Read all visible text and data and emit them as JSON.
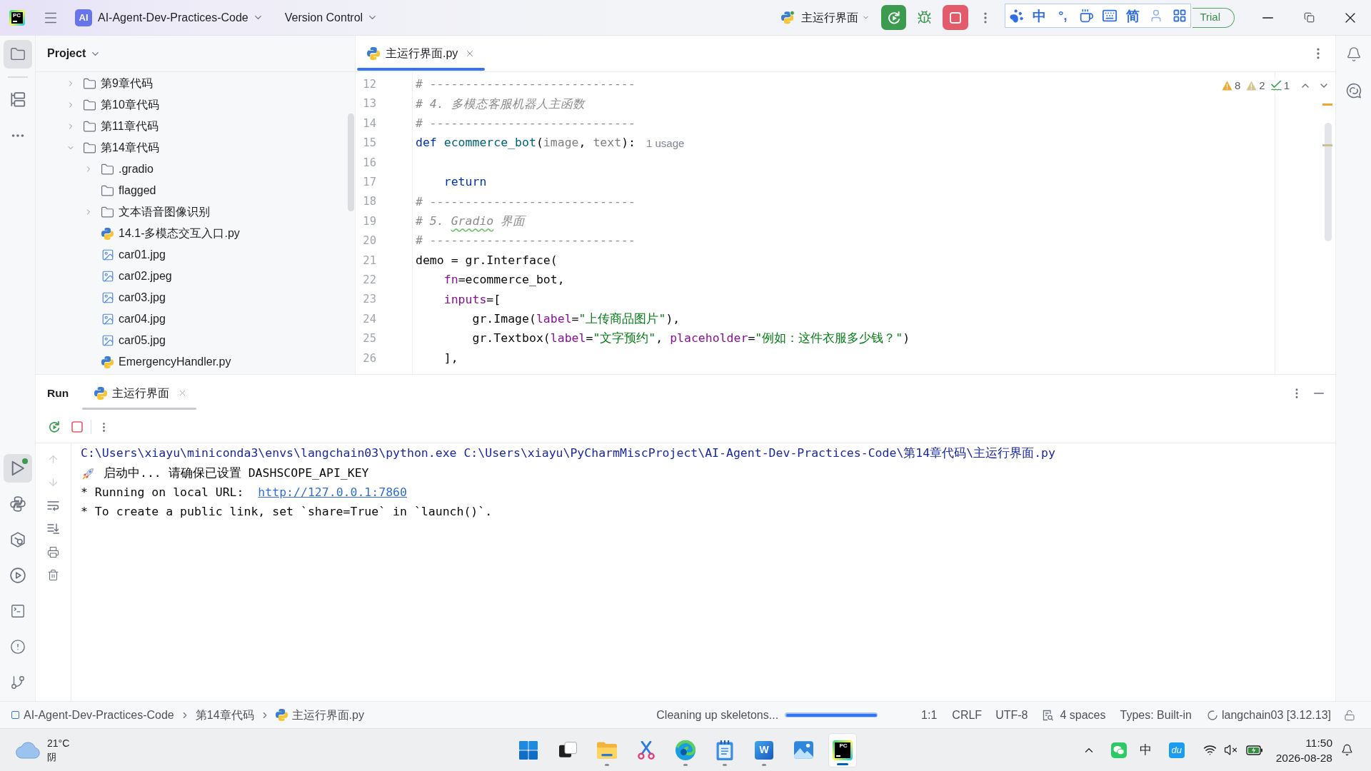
{
  "title_bar": {
    "logo": "PC",
    "project_badge": "AI",
    "project": "AI-Agent-Dev-Practices-Code",
    "vcs": "Version Control",
    "run_config": "主运行界面",
    "trial": "Trial"
  },
  "ime_toolbar": {
    "mode": "中",
    "punctuation": "°,",
    "script": "简"
  },
  "tool_strip": {
    "top": [
      {
        "selected": true
      },
      {
        "selected": false
      }
    ],
    "bottom": [
      {
        "selected": true,
        "running": true
      },
      {
        "selected": false,
        "running": false
      },
      {
        "selected": false,
        "running": false
      },
      {
        "selected": false,
        "running": false
      },
      {
        "selected": false,
        "running": false
      },
      {
        "selected": false,
        "running": false
      },
      {
        "selected": false,
        "running": false
      }
    ]
  },
  "project_panel": {
    "title": "Project",
    "tree": [
      {
        "label": "第9章代码",
        "kind": "folder",
        "expanded": false
      },
      {
        "label": "第10章代码",
        "kind": "folder",
        "expanded": false
      },
      {
        "label": "第11章代码",
        "kind": "folder",
        "expanded": false
      },
      {
        "label": "第14章代码",
        "kind": "folder",
        "expanded": true,
        "children": [
          {
            "label": ".gradio",
            "kind": "folder",
            "expanded": false
          },
          {
            "label": "flagged",
            "kind": "empty_folder"
          },
          {
            "label": "文本语音图像识别",
            "kind": "folder",
            "expanded": false
          },
          {
            "label": "14.1-多模态交互入口.py",
            "kind": "python"
          },
          {
            "label": "car01.jpg",
            "kind": "image"
          },
          {
            "label": "car02.jpeg",
            "kind": "image"
          },
          {
            "label": "car03.jpg",
            "kind": "image"
          },
          {
            "label": "car04.jpg",
            "kind": "image"
          },
          {
            "label": "car05.jpg",
            "kind": "image"
          },
          {
            "label": "EmergencyHandler.py",
            "kind": "python"
          }
        ]
      }
    ]
  },
  "editor": {
    "tabs": [
      {
        "label": "主运行界面.py",
        "selected": true
      }
    ],
    "inspections": {
      "warnings": "8",
      "weak_warnings": "2",
      "passed": "1"
    },
    "lines": [
      {
        "number": "12",
        "tokens": [
          {
            "kind": "comment",
            "text": "# -----------------------------"
          }
        ]
      },
      {
        "number": "13",
        "tokens": [
          {
            "kind": "comment",
            "text": "# 4. 多模态客服机器人主函数"
          }
        ]
      },
      {
        "number": "14",
        "tokens": [
          {
            "kind": "comment",
            "text": "# -----------------------------"
          }
        ]
      },
      {
        "number": "15",
        "tokens": [
          {
            "kind": "keyword",
            "text": "def "
          },
          {
            "kind": "function",
            "text": "ecommerce_bot"
          },
          {
            "kind": "plain",
            "text": "("
          },
          {
            "kind": "param",
            "text": "image"
          },
          {
            "kind": "plain",
            "text": ", "
          },
          {
            "kind": "param",
            "text": "text"
          },
          {
            "kind": "plain",
            "text": "):"
          },
          {
            "kind": "inlay",
            "text": "1 usage"
          }
        ]
      },
      {
        "number": "16"
      },
      {
        "number": "17",
        "tokens": [
          {
            "kind": "keyword",
            "text": "    return"
          }
        ]
      },
      {
        "number": "18",
        "tokens": [
          {
            "kind": "comment",
            "text": "# -----------------------------"
          }
        ]
      },
      {
        "number": "19",
        "tokens": [
          {
            "kind": "comment",
            "text": "# 5. "
          },
          {
            "kind": "typo",
            "text": "Gradio"
          },
          {
            "kind": "comment",
            "text": " 界面"
          }
        ]
      },
      {
        "number": "20",
        "tokens": [
          {
            "kind": "comment",
            "text": "# -----------------------------"
          }
        ]
      },
      {
        "number": "21",
        "tokens": [
          {
            "kind": "plain",
            "text": "demo = gr.Interface("
          }
        ]
      },
      {
        "number": "22",
        "tokens": [
          {
            "kind": "named_arg",
            "text": "    fn"
          },
          {
            "kind": "plain",
            "text": "=ecommerce_bot,"
          }
        ]
      },
      {
        "number": "23",
        "tokens": [
          {
            "kind": "named_arg",
            "text": "    inputs"
          },
          {
            "kind": "plain",
            "text": "=["
          }
        ]
      },
      {
        "number": "24",
        "tokens": [
          {
            "kind": "plain",
            "text": "        gr.Image("
          },
          {
            "kind": "named_arg",
            "text": "label"
          },
          {
            "kind": "plain",
            "text": "="
          },
          {
            "kind": "string",
            "text": "\"上传商品图片\""
          },
          {
            "kind": "plain",
            "text": "),"
          }
        ]
      },
      {
        "number": "25",
        "tokens": [
          {
            "kind": "plain",
            "text": "        gr.Textbox("
          },
          {
            "kind": "named_arg",
            "text": "label"
          },
          {
            "kind": "plain",
            "text": "="
          },
          {
            "kind": "string",
            "text": "\"文字预约\""
          },
          {
            "kind": "plain",
            "text": ", "
          },
          {
            "kind": "named_arg",
            "text": "placeholder"
          },
          {
            "kind": "plain",
            "text": "="
          },
          {
            "kind": "string",
            "text": "\"例如：这件衣服多少钱？\""
          },
          {
            "kind": "plain",
            "text": ")"
          }
        ]
      },
      {
        "number": "26",
        "tokens": [
          {
            "kind": "plain",
            "text": "    ],"
          }
        ]
      }
    ]
  },
  "run_panel": {
    "title": "Run",
    "tabs": [
      {
        "label": "主运行界面",
        "selected": true
      }
    ],
    "tools": [
      {
        "disabled": true
      },
      {
        "disabled": true
      },
      {
        "disabled": false
      },
      {
        "disabled": false
      },
      {
        "disabled": false
      },
      {
        "disabled": false
      }
    ],
    "output": [
      {
        "kind": "command",
        "parts": [
          {
            "kind": "text",
            "text": "C:\\Users\\xiayu\\miniconda3\\envs\\langchain03\\python.exe C:\\Users\\xiayu\\PyCharmMiscProject\\AI-Agent-Dev-Practices-Code\\第14章代码\\主运行界面.py"
          }
        ]
      },
      {
        "kind": "status",
        "parts": [
          {
            "kind": "text",
            "text": "启动中... 请确保已设置 DASHSCOPE_API_KEY"
          }
        ]
      },
      {
        "kind": "plain",
        "parts": [
          {
            "kind": "text",
            "text": "* Running on local URL:  "
          },
          {
            "kind": "link",
            "text": "http://127.0.0.1:7860"
          }
        ]
      },
      {
        "kind": "plain",
        "parts": [
          {
            "kind": "text",
            "text": "* To create a public link, set `share=True` in `launch()`."
          }
        ]
      }
    ]
  },
  "status_bar": {
    "breadcrumbs": [
      {
        "kind": "module",
        "label": "AI-Agent-Dev-Practices-Code"
      },
      {
        "kind": "folder",
        "label": "第14章代码"
      },
      {
        "kind": "python",
        "label": "主运行界面.py"
      }
    ],
    "task": "Cleaning up skeletons...",
    "progress": {
      "level": 1
    },
    "position": "1:1",
    "line_separator": "CRLF",
    "encoding": "UTF-8",
    "indent": "4 spaces",
    "types": "Types: Built-in",
    "interpreter": "langchain03 [3.12.13]"
  },
  "taskbar": {
    "weather": {
      "temperature": "21°C",
      "condition": "阴"
    },
    "apps": [
      {
        "running": false,
        "selected": false
      },
      {
        "running": false,
        "selected": false
      },
      {
        "running": true,
        "selected": false
      },
      {
        "running": false,
        "selected": false
      },
      {
        "running": true,
        "selected": false
      },
      {
        "running": true,
        "selected": false
      },
      {
        "label": "W",
        "running": true,
        "selected": false
      },
      {
        "running": false,
        "selected": false
      },
      {
        "label": "PC",
        "running": true,
        "selected": true
      }
    ],
    "tray": {
      "ime": "中",
      "badge": "du"
    },
    "time": "11:50",
    "date": "2026-08-28"
  }
}
